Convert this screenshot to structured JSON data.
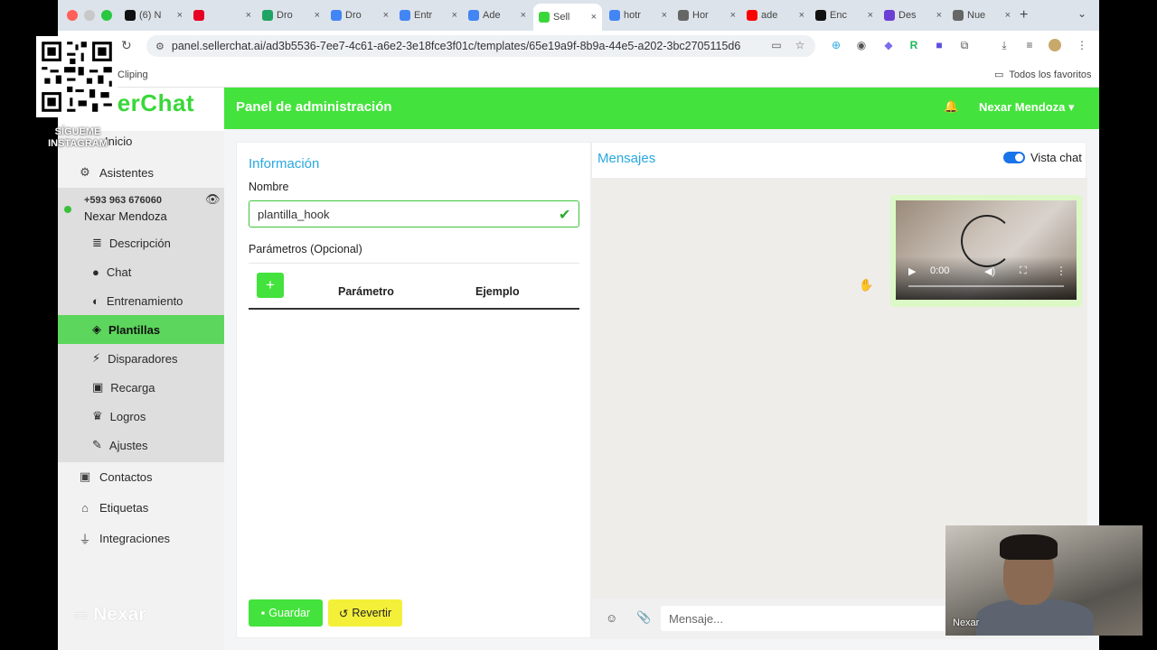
{
  "browser": {
    "tabs": [
      {
        "title": "(6) N",
        "icon": "tiktok-icon",
        "color": "#111111"
      },
      {
        "title": "",
        "icon": "pinterest-icon",
        "color": "#e60023"
      },
      {
        "title": "Dro",
        "icon": "google-drive-icon",
        "color": "#1fa463"
      },
      {
        "title": "Dro",
        "icon": "google-docs-icon",
        "color": "#4285f4"
      },
      {
        "title": "Entr",
        "icon": "google-docs-icon",
        "color": "#4285f4"
      },
      {
        "title": "Ade",
        "icon": "google-docs-icon",
        "color": "#4285f4"
      },
      {
        "title": "Sell",
        "icon": "sellerchat-icon",
        "color": "#3ad73a",
        "active": true
      },
      {
        "title": "hotr",
        "icon": "google-icon",
        "color": "#4285f4"
      },
      {
        "title": "Hor",
        "icon": "globe-icon",
        "color": "#666666"
      },
      {
        "title": "ade",
        "icon": "youtube-icon",
        "color": "#ff0000"
      },
      {
        "title": "Enc",
        "icon": "tiktok-icon",
        "color": "#111111"
      },
      {
        "title": "Des",
        "icon": "app-icon",
        "color": "#6b3fd4"
      },
      {
        "title": "Nue",
        "icon": "chrome-icon",
        "color": "#666666"
      }
    ],
    "url": "panel.sellerchat.ai/ad3b5536-7ee7-4c61-a6e2-3e18fce3f01c/templates/65e19a9f-8b9a-44e5-a202-3bc2705115d6",
    "bookmark_clip": "Cliping",
    "bookmark_all": "Todos los favoritos"
  },
  "app": {
    "brand": "SellerChat",
    "brand_visible": "lerChat",
    "topbar_title": "Panel de administración",
    "user_menu": "Nexar Mendoza ▾",
    "nav": {
      "inicio": "Inicio",
      "asistentes": "Asistentes",
      "assistant_phone": "+593 963 676060",
      "assistant_name": "Nexar Mendoza",
      "sub": [
        {
          "label": "Descripción",
          "icon": "list-icon"
        },
        {
          "label": "Chat",
          "icon": "chat-icon"
        },
        {
          "label": "Entrenamiento",
          "icon": "brain-icon"
        },
        {
          "label": "Plantillas",
          "icon": "layers-icon",
          "active": true
        },
        {
          "label": "Disparadores",
          "icon": "bolt-icon"
        },
        {
          "label": "Recarga",
          "icon": "money-icon"
        },
        {
          "label": "Logros",
          "icon": "trophy-icon"
        },
        {
          "label": "Ajustes",
          "icon": "wrench-icon"
        }
      ],
      "contactos": "Contactos",
      "etiquetas": "Etiquetas",
      "integraciones": "Integraciones",
      "footer_logo": "Nexar"
    },
    "info": {
      "title": "Información",
      "name_label": "Nombre",
      "name_value": "plantilla_hook",
      "params_label": "Parámetros (Opcional)",
      "col_param": "Parámetro",
      "col_example": "Ejemplo",
      "save": "Guardar",
      "revert": "Revertir"
    },
    "messages": {
      "title": "Mensajes",
      "toggle_label": "Vista chat",
      "video_time": "0:00",
      "input_placeholder": "Mensaje..."
    }
  },
  "overlays": {
    "qr_caption": "SÍGUEME INSTAGRAM",
    "webcam_name": "Nexar"
  },
  "colors": {
    "brand_green": "#44e23c",
    "active_green": "#5cd65c",
    "accent_blue": "#29a8e0",
    "revert_yellow": "#f4f03a"
  }
}
